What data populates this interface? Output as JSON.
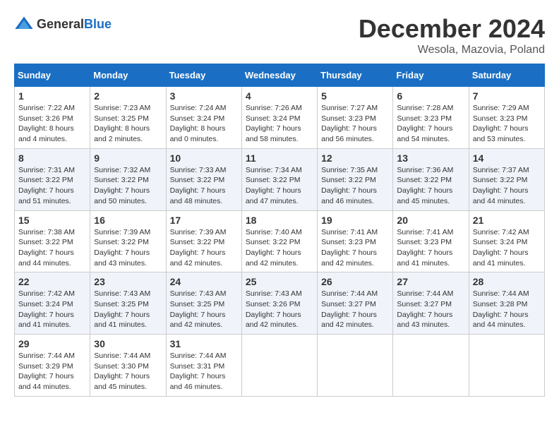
{
  "header": {
    "logo_general": "General",
    "logo_blue": "Blue",
    "month_title": "December 2024",
    "location": "Wesola, Mazovia, Poland"
  },
  "calendar": {
    "days_of_week": [
      "Sunday",
      "Monday",
      "Tuesday",
      "Wednesday",
      "Thursday",
      "Friday",
      "Saturday"
    ],
    "weeks": [
      [
        null,
        null,
        null,
        null,
        null,
        null,
        null
      ]
    ],
    "cells": [
      {
        "day": "1",
        "sunrise": "7:22 AM",
        "sunset": "3:26 PM",
        "daylight": "8 hours and 4 minutes."
      },
      {
        "day": "2",
        "sunrise": "7:23 AM",
        "sunset": "3:25 PM",
        "daylight": "8 hours and 2 minutes."
      },
      {
        "day": "3",
        "sunrise": "7:24 AM",
        "sunset": "3:24 PM",
        "daylight": "8 hours and 0 minutes."
      },
      {
        "day": "4",
        "sunrise": "7:26 AM",
        "sunset": "3:24 PM",
        "daylight": "7 hours and 58 minutes."
      },
      {
        "day": "5",
        "sunrise": "7:27 AM",
        "sunset": "3:23 PM",
        "daylight": "7 hours and 56 minutes."
      },
      {
        "day": "6",
        "sunrise": "7:28 AM",
        "sunset": "3:23 PM",
        "daylight": "7 hours and 54 minutes."
      },
      {
        "day": "7",
        "sunrise": "7:29 AM",
        "sunset": "3:23 PM",
        "daylight": "7 hours and 53 minutes."
      },
      {
        "day": "8",
        "sunrise": "7:31 AM",
        "sunset": "3:22 PM",
        "daylight": "7 hours and 51 minutes."
      },
      {
        "day": "9",
        "sunrise": "7:32 AM",
        "sunset": "3:22 PM",
        "daylight": "7 hours and 50 minutes."
      },
      {
        "day": "10",
        "sunrise": "7:33 AM",
        "sunset": "3:22 PM",
        "daylight": "7 hours and 48 minutes."
      },
      {
        "day": "11",
        "sunrise": "7:34 AM",
        "sunset": "3:22 PM",
        "daylight": "7 hours and 47 minutes."
      },
      {
        "day": "12",
        "sunrise": "7:35 AM",
        "sunset": "3:22 PM",
        "daylight": "7 hours and 46 minutes."
      },
      {
        "day": "13",
        "sunrise": "7:36 AM",
        "sunset": "3:22 PM",
        "daylight": "7 hours and 45 minutes."
      },
      {
        "day": "14",
        "sunrise": "7:37 AM",
        "sunset": "3:22 PM",
        "daylight": "7 hours and 44 minutes."
      },
      {
        "day": "15",
        "sunrise": "7:38 AM",
        "sunset": "3:22 PM",
        "daylight": "7 hours and 44 minutes."
      },
      {
        "day": "16",
        "sunrise": "7:39 AM",
        "sunset": "3:22 PM",
        "daylight": "7 hours and 43 minutes."
      },
      {
        "day": "17",
        "sunrise": "7:39 AM",
        "sunset": "3:22 PM",
        "daylight": "7 hours and 42 minutes."
      },
      {
        "day": "18",
        "sunrise": "7:40 AM",
        "sunset": "3:22 PM",
        "daylight": "7 hours and 42 minutes."
      },
      {
        "day": "19",
        "sunrise": "7:41 AM",
        "sunset": "3:23 PM",
        "daylight": "7 hours and 42 minutes."
      },
      {
        "day": "20",
        "sunrise": "7:41 AM",
        "sunset": "3:23 PM",
        "daylight": "7 hours and 41 minutes."
      },
      {
        "day": "21",
        "sunrise": "7:42 AM",
        "sunset": "3:24 PM",
        "daylight": "7 hours and 41 minutes."
      },
      {
        "day": "22",
        "sunrise": "7:42 AM",
        "sunset": "3:24 PM",
        "daylight": "7 hours and 41 minutes."
      },
      {
        "day": "23",
        "sunrise": "7:43 AM",
        "sunset": "3:25 PM",
        "daylight": "7 hours and 41 minutes."
      },
      {
        "day": "24",
        "sunrise": "7:43 AM",
        "sunset": "3:25 PM",
        "daylight": "7 hours and 42 minutes."
      },
      {
        "day": "25",
        "sunrise": "7:43 AM",
        "sunset": "3:26 PM",
        "daylight": "7 hours and 42 minutes."
      },
      {
        "day": "26",
        "sunrise": "7:44 AM",
        "sunset": "3:27 PM",
        "daylight": "7 hours and 42 minutes."
      },
      {
        "day": "27",
        "sunrise": "7:44 AM",
        "sunset": "3:27 PM",
        "daylight": "7 hours and 43 minutes."
      },
      {
        "day": "28",
        "sunrise": "7:44 AM",
        "sunset": "3:28 PM",
        "daylight": "7 hours and 44 minutes."
      },
      {
        "day": "29",
        "sunrise": "7:44 AM",
        "sunset": "3:29 PM",
        "daylight": "7 hours and 44 minutes."
      },
      {
        "day": "30",
        "sunrise": "7:44 AM",
        "sunset": "3:30 PM",
        "daylight": "7 hours and 45 minutes."
      },
      {
        "day": "31",
        "sunrise": "7:44 AM",
        "sunset": "3:31 PM",
        "daylight": "7 hours and 46 minutes."
      }
    ],
    "labels": {
      "sunrise": "Sunrise:",
      "sunset": "Sunset:",
      "daylight": "Daylight:"
    }
  }
}
